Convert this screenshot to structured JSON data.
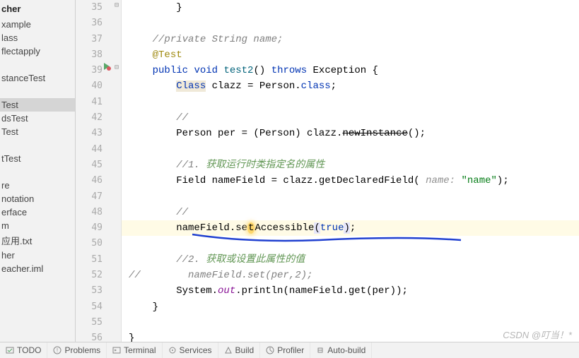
{
  "sidebar": {
    "header": "cher",
    "items": [
      "xample",
      "lass",
      "flectapply",
      "",
      "stanceTest",
      "",
      "Test",
      "dsTest",
      "Test",
      "",
      "tTest",
      "",
      "re",
      "notation",
      "erface",
      "m",
      "应用.txt",
      "her",
      "eacher.iml"
    ],
    "selected": 6
  },
  "gutter": {
    "start": 35,
    "end": 56,
    "run_icon_line": 39
  },
  "code": {
    "lines": [
      {
        "n": 35,
        "seg": [
          [
            "        }",
            ""
          ]
        ]
      },
      {
        "n": 36,
        "seg": [
          [
            "",
            ""
          ]
        ]
      },
      {
        "n": 37,
        "seg": [
          [
            "    ",
            ""
          ],
          [
            "//private String name;",
            "cmt"
          ]
        ]
      },
      {
        "n": 38,
        "seg": [
          [
            "    ",
            ""
          ],
          [
            "@Test",
            "anno"
          ]
        ]
      },
      {
        "n": 39,
        "seg": [
          [
            "    ",
            ""
          ],
          [
            "public",
            "kw"
          ],
          [
            " ",
            ""
          ],
          [
            "void",
            "kw"
          ],
          [
            " ",
            ""
          ],
          [
            "test2",
            "method"
          ],
          [
            "() ",
            ""
          ],
          [
            "throws",
            "kw"
          ],
          [
            " Exception {",
            ""
          ]
        ]
      },
      {
        "n": 40,
        "seg": [
          [
            "        ",
            ""
          ],
          [
            "Class",
            "class-hl kw"
          ],
          [
            " clazz = Person.",
            ""
          ],
          [
            "class",
            "kw"
          ],
          [
            ";",
            ""
          ]
        ]
      },
      {
        "n": 41,
        "seg": [
          [
            "",
            ""
          ]
        ]
      },
      {
        "n": 42,
        "seg": [
          [
            "        ",
            ""
          ],
          [
            "//",
            "cmt"
          ]
        ]
      },
      {
        "n": 43,
        "seg": [
          [
            "        Person per = (Person) clazz.",
            ""
          ],
          [
            "newInstance",
            "strike"
          ],
          [
            "();",
            ""
          ]
        ]
      },
      {
        "n": 44,
        "seg": [
          [
            "",
            ""
          ]
        ]
      },
      {
        "n": 45,
        "seg": [
          [
            "        ",
            ""
          ],
          [
            "//1. ",
            "cmt"
          ],
          [
            "获取运行时类指定名的属性",
            "cmt-cn"
          ]
        ]
      },
      {
        "n": 46,
        "seg": [
          [
            "        Field nameField = clazz.getDeclaredField( ",
            ""
          ],
          [
            "name: ",
            "hint"
          ],
          [
            "\"name\"",
            "str"
          ],
          [
            ");",
            ""
          ]
        ]
      },
      {
        "n": 47,
        "seg": [
          [
            "",
            ""
          ]
        ]
      },
      {
        "n": 48,
        "seg": [
          [
            "        ",
            ""
          ],
          [
            "//",
            "cmt"
          ]
        ]
      },
      {
        "n": 49,
        "hl": true,
        "seg": [
          [
            "        nameField.se",
            ""
          ],
          [
            "t",
            "caret-box"
          ],
          [
            "Accessible",
            ""
          ],
          [
            "(",
            "bracket-hl"
          ],
          [
            "true",
            "kw"
          ],
          [
            ")",
            "bracket-hl"
          ],
          [
            ";",
            ""
          ]
        ]
      },
      {
        "n": 50,
        "seg": [
          [
            "",
            ""
          ]
        ]
      },
      {
        "n": 51,
        "seg": [
          [
            "        ",
            ""
          ],
          [
            "//2. ",
            "cmt"
          ],
          [
            "获取或设置此属性的值",
            "cmt-cn"
          ]
        ]
      },
      {
        "n": 52,
        "seg": [
          [
            "//        nameField.set(per,2);",
            "cmt"
          ]
        ]
      },
      {
        "n": 53,
        "seg": [
          [
            "        System.",
            ""
          ],
          [
            "out",
            "field-it"
          ],
          [
            ".println(nameField.get(per));",
            ""
          ]
        ]
      },
      {
        "n": 54,
        "seg": [
          [
            "    }",
            ""
          ]
        ]
      },
      {
        "n": 55,
        "seg": [
          [
            "",
            ""
          ]
        ]
      },
      {
        "n": 56,
        "seg": [
          [
            "}",
            ""
          ]
        ]
      }
    ]
  },
  "bottom": {
    "items": [
      {
        "icon": "todo-icon",
        "label": "TODO"
      },
      {
        "icon": "problems-icon",
        "label": "Problems"
      },
      {
        "icon": "terminal-icon",
        "label": "Terminal"
      },
      {
        "icon": "services-icon",
        "label": "Services"
      },
      {
        "icon": "build-icon",
        "label": "Build"
      },
      {
        "icon": "profiler-icon",
        "label": "Profiler"
      },
      {
        "icon": "autobuild-icon",
        "label": "Auto-build"
      }
    ]
  },
  "watermark": "CSDN @叮当！*"
}
